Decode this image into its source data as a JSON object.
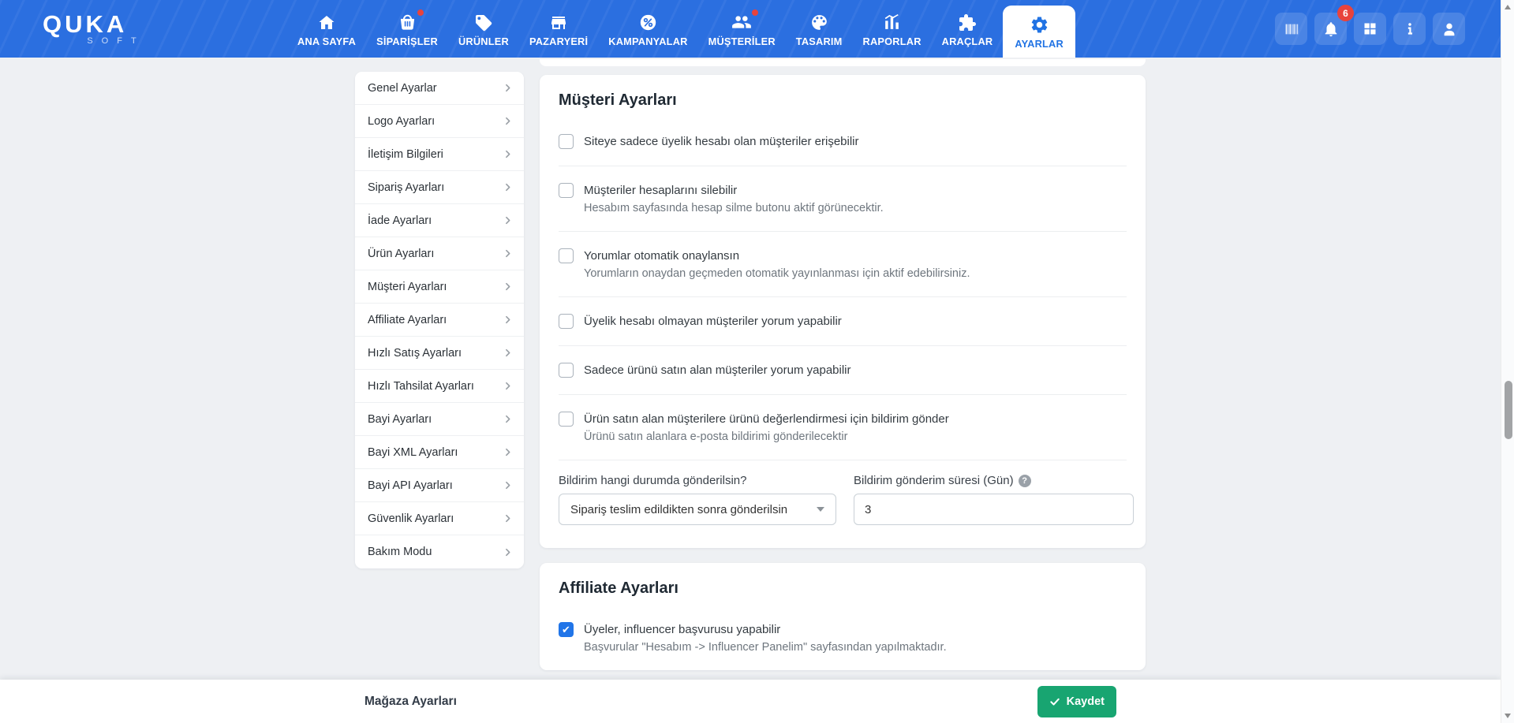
{
  "nav": {
    "logo": {
      "line1": "QUKA",
      "line2": "SOFT"
    },
    "items": [
      {
        "label": "ANA SAYFA",
        "icon": "home-icon",
        "active": false,
        "dot": false
      },
      {
        "label": "SİPARİŞLER",
        "icon": "basket-icon",
        "active": false,
        "dot": true
      },
      {
        "label": "ÜRÜNLER",
        "icon": "tag-icon",
        "active": false,
        "dot": false
      },
      {
        "label": "PAZARYERİ",
        "icon": "storefront-icon",
        "active": false,
        "dot": false
      },
      {
        "label": "KAMPANYALAR",
        "icon": "percent-icon",
        "active": false,
        "dot": false
      },
      {
        "label": "MÜŞTERİLER",
        "icon": "users-icon",
        "active": false,
        "dot": true
      },
      {
        "label": "TASARIM",
        "icon": "palette-icon",
        "active": false,
        "dot": false
      },
      {
        "label": "RAPORLAR",
        "icon": "chart-icon",
        "active": false,
        "dot": false
      },
      {
        "label": "ARAÇLAR",
        "icon": "puzzle-icon",
        "active": false,
        "dot": false
      },
      {
        "label": "AYARLAR",
        "icon": "gear-icon",
        "active": true,
        "dot": false
      }
    ],
    "notification_count": "6",
    "quick_icons": [
      "barcode-icon",
      "bell-icon",
      "apps-grid-icon",
      "info-icon",
      "user-icon"
    ]
  },
  "sidebar": {
    "items": [
      "Genel Ayarlar",
      "Logo Ayarları",
      "İletişim Bilgileri",
      "Sipariş Ayarları",
      "İade Ayarları",
      "Ürün Ayarları",
      "Müşteri Ayarları",
      "Affiliate Ayarları",
      "Hızlı Satış Ayarları",
      "Hızlı Tahsilat Ayarları",
      "Bayi Ayarları",
      "Bayi XML Ayarları",
      "Bayi API Ayarları",
      "Güvenlik Ayarları",
      "Bakım Modu"
    ]
  },
  "customer_settings": {
    "title": "Müşteri Ayarları",
    "rows": [
      {
        "label": "Siteye sadece üyelik hesabı olan müşteriler erişebilir",
        "helper": "",
        "checked": false
      },
      {
        "label": "Müşteriler hesaplarını silebilir",
        "helper": "Hesabım sayfasında hesap silme butonu aktif görünecektir.",
        "checked": false
      },
      {
        "label": "Yorumlar otomatik onaylansın",
        "helper": "Yorumların onaydan geçmeden otomatik yayınlanması için aktif edebilirsiniz.",
        "checked": false
      },
      {
        "label": "Üyelik hesabı olmayan müşteriler yorum yapabilir",
        "helper": "",
        "checked": false
      },
      {
        "label": "Sadece ürünü satın alan müşteriler yorum yapabilir",
        "helper": "",
        "checked": false
      },
      {
        "label": "Ürün satın alan müşterilere ürünü değerlendirmesi için bildirim gönder",
        "helper": "Ürünü satın alanlara e-posta bildirimi gönderilecektir",
        "checked": false
      }
    ],
    "form": {
      "select_label": "Bildirim hangi durumda gönderilsin?",
      "select_value": "Sipariş teslim edildikten sonra gönderilsin",
      "input_label": "Bildirim gönderim süresi (Gün)",
      "help_glyph": "?",
      "input_value": "3"
    }
  },
  "affiliate_settings": {
    "title": "Affiliate Ayarları",
    "rows": [
      {
        "label": "Üyeler, influencer başvurusu yapabilir",
        "helper": "Başvurular \"Hesabım -> Influencer Panelim\" sayfasından yapılmaktadır.",
        "checked": true
      }
    ]
  },
  "footer": {
    "page_title": "Mağaza Ayarları",
    "save_label": "Kaydet"
  },
  "colors": {
    "navbar_blue": "#2b6fe0",
    "active_blue": "#2173e4",
    "save_green": "#18a571",
    "badge_red": "#e8433c"
  }
}
